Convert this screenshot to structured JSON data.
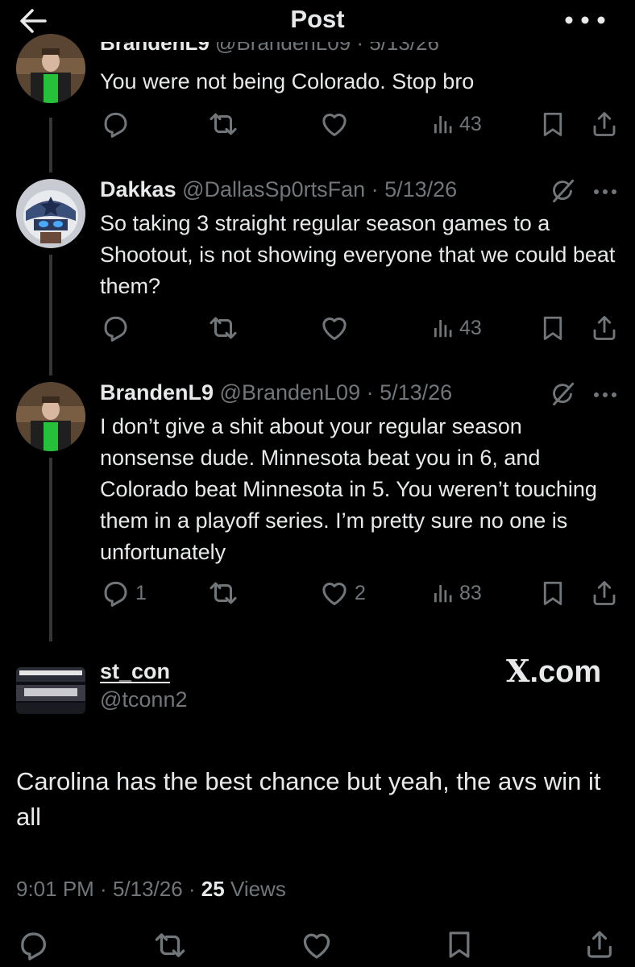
{
  "header": {
    "title": "Post"
  },
  "tweets": [
    {
      "text": "You were not being Colorado. Stop bro",
      "replies": "",
      "reposts": "",
      "likes": "",
      "views": "43"
    },
    {
      "name": "Dakkas",
      "handle": "@DallasSp0rtsFan",
      "date": "5/13/26",
      "text": "So taking 3 straight regular season games to a Shootout, is not showing everyone that we could beat them?",
      "replies": "",
      "reposts": "",
      "likes": "",
      "views": "43"
    },
    {
      "name": "BrandenL9",
      "handle": "@BrandenL09",
      "date": "5/13/26",
      "text": "I don’t give a shit about your regular season nonsense dude. Minnesota beat you in 6, and Colorado beat Minnesota in 5. You weren’t touching them in a playoff series. I’m pretty sure no one is unfortunately",
      "replies": "1",
      "reposts": "",
      "likes": "2",
      "views": "83"
    }
  ],
  "main_post": {
    "name": "st_con",
    "handle": "@tconn2",
    "watermark": "X.com",
    "text": "Carolina has the best chance but yeah, the avs win it all",
    "time": "9:01 PM",
    "date": "5/13/26",
    "views_count": "25",
    "views_label": "Views"
  },
  "icons": {
    "back": "arrow-left-icon",
    "more": "more-horizontal-icon",
    "reply": "reply-icon",
    "repost": "repost-icon",
    "like": "heart-icon",
    "views": "views-chart-icon",
    "bookmark": "bookmark-icon",
    "share": "share-icon",
    "grok": "grok-icon"
  },
  "colors": {
    "background": "#000000",
    "text": "#e7e9ea",
    "secondary": "#71767b",
    "line": "#333639"
  }
}
